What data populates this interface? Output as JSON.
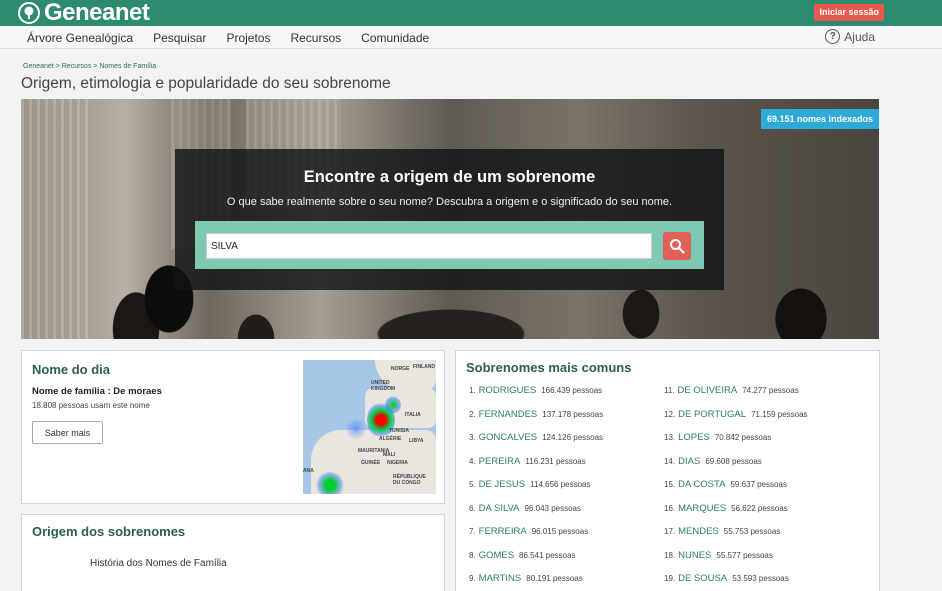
{
  "header": {
    "logo": "Geneanet",
    "login": "Iniciar sessão"
  },
  "nav": {
    "items": [
      "Árvore Genealógica",
      "Pesquisar",
      "Projetos",
      "Recursos",
      "Comunidade"
    ],
    "help": "Ajuda"
  },
  "breadcrumb": [
    "Geneanet",
    ">",
    "Recursos",
    ">",
    "Nomes de Família"
  ],
  "page_title": "Origem, etimologia e popularidade do seu sobrenome",
  "hero": {
    "badge": "69.151 nomes indexados",
    "title": "Encontre a origem de um sobrenome",
    "subtitle": "O que sabe realmente sobre o seu nome? Descubra a origem e o significado do seu nome.",
    "search_value": "SILVA"
  },
  "nome_do_dia": {
    "title": "Nome do dia",
    "label": "Nome de família : De moraes",
    "count": "18.808 pessoas usam este nome",
    "button": "Saber mais",
    "map_labels": [
      "NORGE",
      "FINLAND",
      "UNITED KINGDOM",
      "ITALIA",
      "TUNISIA",
      "ALGÉRIE",
      "LIBYA",
      "MAURITANIA",
      "MALI",
      "GUINÉE",
      "NIGERIA",
      "RÉPUBLIQUE DU CONGO",
      "ANA"
    ]
  },
  "origem": {
    "title": "Origem dos sobrenomes",
    "link": "História dos Nomes de Família"
  },
  "comuns": {
    "title": "Sobrenomes mais comuns",
    "left": [
      {
        "rank": "1.",
        "name": "RODRIGUES",
        "count": "166.439 pessoas"
      },
      {
        "rank": "2.",
        "name": "FERNANDES",
        "count": "137.178 pessoas"
      },
      {
        "rank": "3.",
        "name": "GONCALVES",
        "count": "124.126 pessoas"
      },
      {
        "rank": "4.",
        "name": "PEREIRA",
        "count": "116.231 pessoas"
      },
      {
        "rank": "5.",
        "name": "DE JESUS",
        "count": "114.656 pessoas"
      },
      {
        "rank": "6.",
        "name": "DA SILVA",
        "count": "96.043 pessoas"
      },
      {
        "rank": "7.",
        "name": "FERREIRA",
        "count": "96.015 pessoas"
      },
      {
        "rank": "8.",
        "name": "GOMES",
        "count": "86.541 pessoas"
      },
      {
        "rank": "9.",
        "name": "MARTINS",
        "count": "80.191 pessoas"
      }
    ],
    "right": [
      {
        "rank": "11.",
        "name": "DE OLIVEIRA",
        "count": "74.277 pessoas"
      },
      {
        "rank": "12.",
        "name": "DE PORTUGAL",
        "count": "71.159 pessoas"
      },
      {
        "rank": "13.",
        "name": "LOPES",
        "count": "70.842 pessoas"
      },
      {
        "rank": "14.",
        "name": "DIAS",
        "count": "69.608 pessoas"
      },
      {
        "rank": "15.",
        "name": "DA COSTA",
        "count": "59.637 pessoas"
      },
      {
        "rank": "16.",
        "name": "MARQUES",
        "count": "56.622 pessoas"
      },
      {
        "rank": "17.",
        "name": "MENDES",
        "count": "55.753 pessoas"
      },
      {
        "rank": "18.",
        "name": "NUNES",
        "count": "55.577 pessoas"
      },
      {
        "rank": "19.",
        "name": "DE SOUSA",
        "count": "53.593 pessoas"
      }
    ]
  },
  "colors": {
    "brand": "#2e8b6f",
    "accent": "#e0605a",
    "badge": "#2eaad8"
  },
  "icons": [
    "tree-logo-icon",
    "help-icon",
    "search-icon"
  ]
}
